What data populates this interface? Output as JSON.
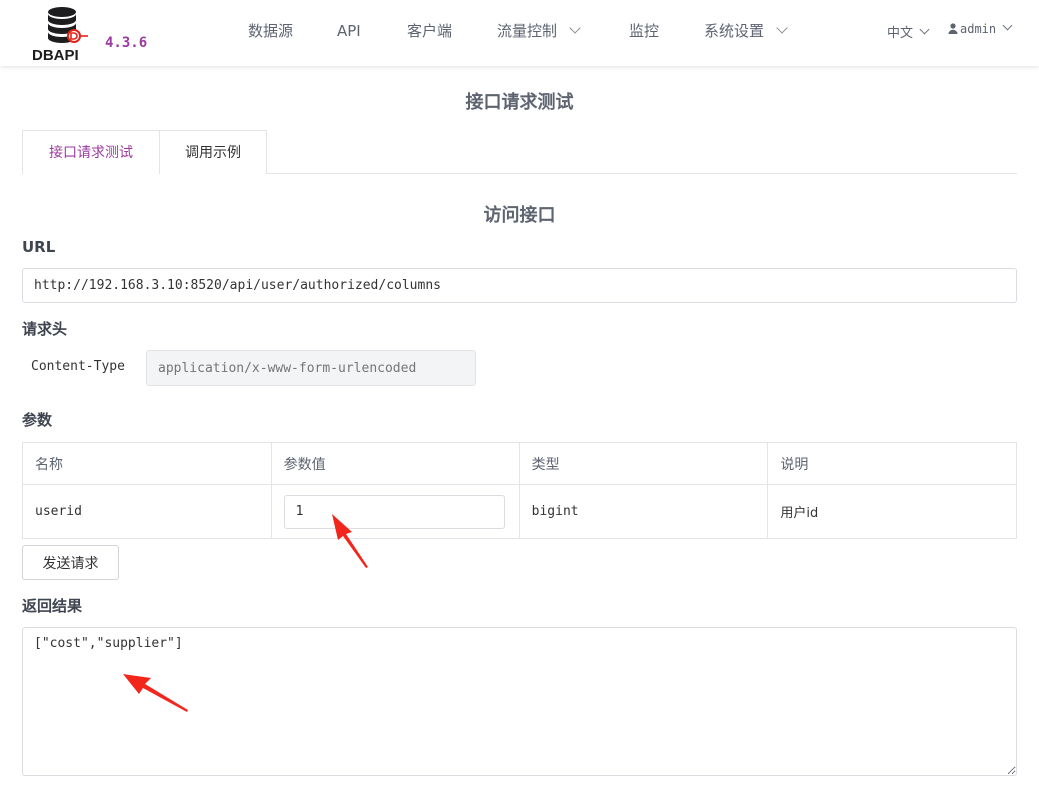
{
  "brand": {
    "logo_text": "DBAPI",
    "version": "4.3.6"
  },
  "nav": {
    "items": [
      {
        "label": "数据源",
        "dropdown": false
      },
      {
        "label": "API",
        "dropdown": false
      },
      {
        "label": "客户端",
        "dropdown": false
      },
      {
        "label": "流量控制",
        "dropdown": true
      },
      {
        "label": "监控",
        "dropdown": false
      },
      {
        "label": "系统设置",
        "dropdown": true
      }
    ],
    "language": "中文",
    "user": "admin"
  },
  "page_title": "接口请求测试",
  "tabs": [
    {
      "label": "接口请求测试",
      "active": true
    },
    {
      "label": "调用示例",
      "active": false
    }
  ],
  "section_title": "访问接口",
  "url": {
    "label": "URL",
    "value": "http://192.168.3.10:8520/api/user/authorized/columns"
  },
  "headers": {
    "label": "请求头",
    "items": [
      {
        "key": "Content-Type",
        "placeholder": "application/x-www-form-urlencoded"
      }
    ]
  },
  "params": {
    "label": "参数",
    "columns": [
      "名称",
      "参数值",
      "类型",
      "说明"
    ],
    "rows": [
      {
        "name": "userid",
        "value": "1",
        "type": "bigint",
        "desc": "用户id"
      }
    ]
  },
  "send_button": "发送请求",
  "result": {
    "label": "返回结果",
    "value": "[\"cost\",\"supplier\"]"
  },
  "colors": {
    "accent": "#9b3aa0",
    "annotation_arrow": "#f2261b"
  }
}
